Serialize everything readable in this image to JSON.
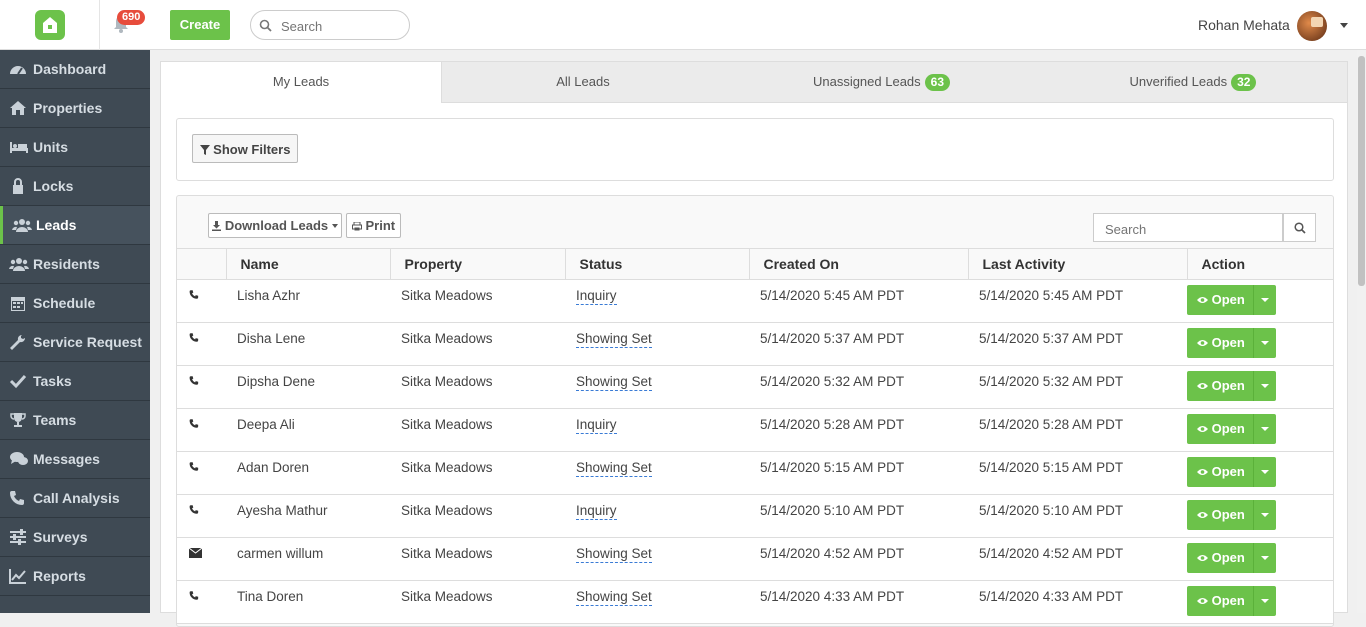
{
  "header": {
    "notification_count": "690",
    "create_label": "Create",
    "search_placeholder": "Search",
    "user_name": "Rohan Mehata"
  },
  "sidebar": {
    "items": [
      {
        "label": "Dashboard",
        "icon": "dashboard-icon"
      },
      {
        "label": "Properties",
        "icon": "home-icon"
      },
      {
        "label": "Units",
        "icon": "bed-icon"
      },
      {
        "label": "Locks",
        "icon": "lock-icon"
      },
      {
        "label": "Leads",
        "icon": "users-icon",
        "active": true
      },
      {
        "label": "Residents",
        "icon": "users-icon"
      },
      {
        "label": "Schedule",
        "icon": "calendar-icon"
      },
      {
        "label": "Service Request",
        "icon": "wrench-icon"
      },
      {
        "label": "Tasks",
        "icon": "check-icon"
      },
      {
        "label": "Teams",
        "icon": "trophy-icon"
      },
      {
        "label": "Messages",
        "icon": "chat-icon"
      },
      {
        "label": "Call Analysis",
        "icon": "phone-icon"
      },
      {
        "label": "Surveys",
        "icon": "sliders-icon"
      },
      {
        "label": "Reports",
        "icon": "chart-icon"
      }
    ]
  },
  "tabs": [
    {
      "label": "My Leads"
    },
    {
      "label": "All Leads"
    },
    {
      "label": "Unassigned Leads",
      "count": "63"
    },
    {
      "label": "Unverified Leads",
      "count": "32"
    }
  ],
  "filters": {
    "show_filters_label": "Show Filters"
  },
  "toolbar": {
    "download_label": "Download Leads",
    "print_label": "Print",
    "search_placeholder": "Search"
  },
  "table": {
    "headers": [
      "Name",
      "Property",
      "Status",
      "Created On",
      "Last Activity",
      "Action"
    ],
    "action_label": "Open",
    "rows": [
      {
        "contact": "phone",
        "name": "Lisha Azhr",
        "property": "Sitka Meadows",
        "status": "Inquiry",
        "created": "5/14/2020 5:45 AM PDT",
        "activity": "5/14/2020 5:45 AM PDT"
      },
      {
        "contact": "phone",
        "name": "Disha Lene",
        "property": "Sitka Meadows",
        "status": "Showing Set",
        "created": "5/14/2020 5:37 AM PDT",
        "activity": "5/14/2020 5:37 AM PDT"
      },
      {
        "contact": "phone",
        "name": "Dipsha Dene",
        "property": "Sitka Meadows",
        "status": "Showing Set",
        "created": "5/14/2020 5:32 AM PDT",
        "activity": "5/14/2020 5:32 AM PDT"
      },
      {
        "contact": "phone",
        "name": "Deepa Ali",
        "property": "Sitka Meadows",
        "status": "Inquiry",
        "created": "5/14/2020 5:28 AM PDT",
        "activity": "5/14/2020 5:28 AM PDT"
      },
      {
        "contact": "phone",
        "name": "Adan Doren",
        "property": "Sitka Meadows",
        "status": "Showing Set",
        "created": "5/14/2020 5:15 AM PDT",
        "activity": "5/14/2020 5:15 AM PDT"
      },
      {
        "contact": "phone",
        "name": "Ayesha Mathur",
        "property": "Sitka Meadows",
        "status": "Inquiry",
        "created": "5/14/2020 5:10 AM PDT",
        "activity": "5/14/2020 5:10 AM PDT"
      },
      {
        "contact": "email",
        "name": "carmen willum",
        "property": "Sitka Meadows",
        "status": "Showing Set",
        "created": "5/14/2020 4:52 AM PDT",
        "activity": "5/14/2020 4:52 AM PDT"
      },
      {
        "contact": "phone",
        "name": "Tina Doren",
        "property": "Sitka Meadows",
        "status": "Showing Set",
        "created": "5/14/2020 4:33 AM PDT",
        "activity": "5/14/2020 4:33 AM PDT"
      }
    ]
  },
  "colors": {
    "accent": "#6cc24a",
    "sidebar": "#3f4a54",
    "badge": "#e74c3c"
  }
}
